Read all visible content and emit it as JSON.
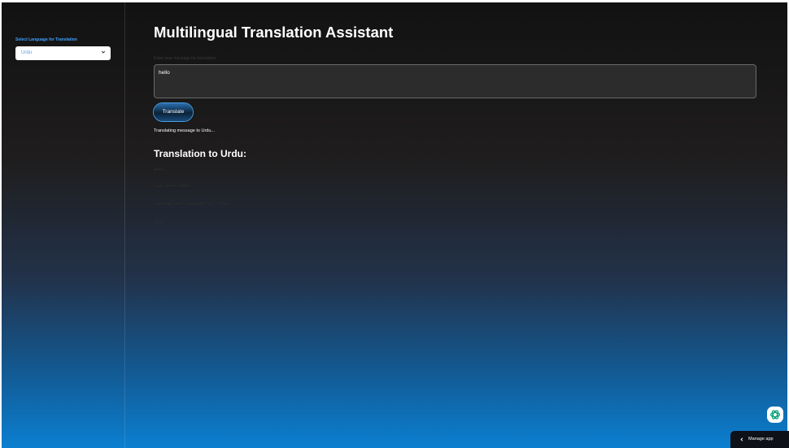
{
  "sidebar": {
    "language_label": "Select Language for Translation",
    "language_selected": "Urdu"
  },
  "main": {
    "title": "Multilingual Translation Assistant",
    "input_label": "Enter your message for translation:",
    "input_value": "hello",
    "translate_button": "Translate",
    "status": "Translating message to Urdu...",
    "result_heading": "Translation to Urdu:",
    "result_lines": [
      "ہیلو",
      "ہیلو، کیسے ہیں؟",
      "ہیلو، آپ کیسے ہیں؟ میں ٹھیک ہوں",
      "ہیلو"
    ]
  },
  "footer": {
    "manage_app": "Manage app"
  },
  "icons": {
    "select_chevron": "chevron-down-icon",
    "manage_chevron": "chevron-left-icon",
    "assistant": "openai-logo-icon"
  }
}
